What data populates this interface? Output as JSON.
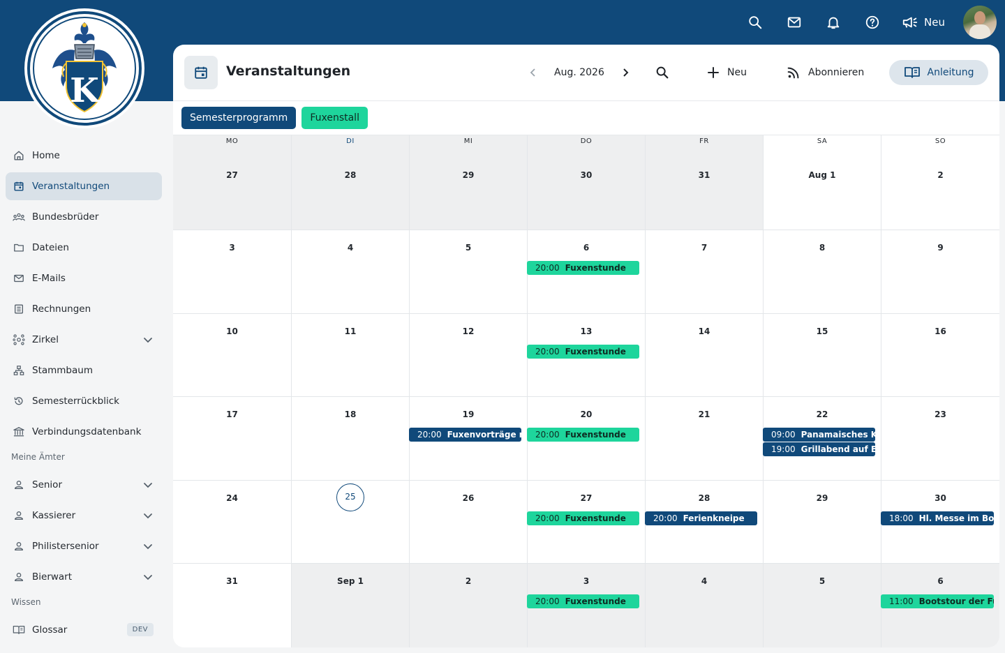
{
  "colors": {
    "brand": "#10497a",
    "accent_green": "#1ed59c"
  },
  "topbar": {
    "icons": [
      "search-icon",
      "mail-icon",
      "bell-icon",
      "help-icon"
    ],
    "announce_label": "Neu"
  },
  "logo": {
    "letter": "K"
  },
  "sidebar": {
    "items": [
      {
        "label": "Home",
        "icon": "home-icon"
      },
      {
        "label": "Veranstaltungen",
        "icon": "calendar-icon",
        "active": true
      },
      {
        "label": "Bundesbrüder",
        "icon": "people-icon"
      },
      {
        "label": "Dateien",
        "icon": "folder-icon"
      },
      {
        "label": "E-Mails",
        "icon": "mail-icon"
      },
      {
        "label": "Rechnungen",
        "icon": "invoice-icon"
      },
      {
        "label": "Zirkel",
        "icon": "circle-network-icon",
        "expandable": true
      },
      {
        "label": "Stammbaum",
        "icon": "tree-icon"
      },
      {
        "label": "Semesterrückblick",
        "icon": "history-icon"
      },
      {
        "label": "Verbindungsdatenbank",
        "icon": "bank-icon"
      }
    ],
    "section_offices": "Meine Ämter",
    "offices": [
      {
        "label": "Senior"
      },
      {
        "label": "Kassierer"
      },
      {
        "label": "Philistersenior"
      },
      {
        "label": "Bierwart"
      }
    ],
    "section_knowledge": "Wissen",
    "knowledge": [
      {
        "label": "Glossar",
        "badge": "DEV"
      }
    ]
  },
  "header": {
    "title": "Veranstaltungen",
    "month": "Aug. 2026",
    "new_label": "Neu",
    "subscribe_label": "Abonnieren",
    "guide_label": "Anleitung"
  },
  "filters": [
    {
      "label": "Semesterprogramm",
      "color": "blue"
    },
    {
      "label": "Fuxenstall",
      "color": "green"
    }
  ],
  "calendar": {
    "weekdays": [
      "MO",
      "DI",
      "MI",
      "DO",
      "FR",
      "SA",
      "SO"
    ],
    "today_column": 1,
    "weeks": [
      [
        {
          "day": "27",
          "out": true
        },
        {
          "day": "28",
          "out": true
        },
        {
          "day": "29",
          "out": true
        },
        {
          "day": "30",
          "out": true
        },
        {
          "day": "31",
          "out": true
        },
        {
          "day": "Aug 1"
        },
        {
          "day": "2"
        }
      ],
      [
        {
          "day": "3"
        },
        {
          "day": "4"
        },
        {
          "day": "5"
        },
        {
          "day": "6",
          "events": [
            {
              "time": "20:00",
              "name": "Fuxenstunde",
              "color": "green"
            }
          ]
        },
        {
          "day": "7"
        },
        {
          "day": "8"
        },
        {
          "day": "9"
        }
      ],
      [
        {
          "day": "10"
        },
        {
          "day": "11"
        },
        {
          "day": "12"
        },
        {
          "day": "13",
          "events": [
            {
              "time": "20:00",
              "name": "Fuxenstunde",
              "color": "green"
            }
          ]
        },
        {
          "day": "14"
        },
        {
          "day": "15"
        },
        {
          "day": "16"
        }
      ],
      [
        {
          "day": "17"
        },
        {
          "day": "18"
        },
        {
          "day": "19",
          "events": [
            {
              "time": "20:00",
              "name": "Fuxenvorträge mi",
              "color": "blue"
            }
          ]
        },
        {
          "day": "20",
          "events": [
            {
              "time": "20:00",
              "name": "Fuxenstunde",
              "color": "green"
            }
          ]
        },
        {
          "day": "21"
        },
        {
          "day": "22",
          "events": [
            {
              "time": "09:00",
              "name": "Panamaisches Kaf",
              "color": "blue"
            },
            {
              "time": "19:00",
              "name": "Grillabend auf Ein",
              "color": "blue"
            }
          ]
        },
        {
          "day": "23"
        }
      ],
      [
        {
          "day": "24"
        },
        {
          "day": "25",
          "today": true
        },
        {
          "day": "26"
        },
        {
          "day": "27",
          "events": [
            {
              "time": "20:00",
              "name": "Fuxenstunde",
              "color": "green"
            }
          ]
        },
        {
          "day": "28",
          "events": [
            {
              "time": "20:00",
              "name": "Ferienkneipe",
              "color": "blue"
            }
          ]
        },
        {
          "day": "29"
        },
        {
          "day": "30",
          "events": [
            {
              "time": "18:00",
              "name": "Hl. Messe im Bonr",
              "color": "blue"
            }
          ]
        }
      ],
      [
        {
          "day": "31"
        },
        {
          "day": "Sep 1",
          "out": true
        },
        {
          "day": "2",
          "out": true
        },
        {
          "day": "3",
          "out": true,
          "events": [
            {
              "time": "20:00",
              "name": "Fuxenstunde",
              "color": "green"
            }
          ]
        },
        {
          "day": "4",
          "out": true
        },
        {
          "day": "5",
          "out": true
        },
        {
          "day": "6",
          "out": true,
          "events": [
            {
              "time": "11:00",
              "name": "Bootstour der Fux",
              "color": "green"
            }
          ]
        }
      ]
    ]
  }
}
